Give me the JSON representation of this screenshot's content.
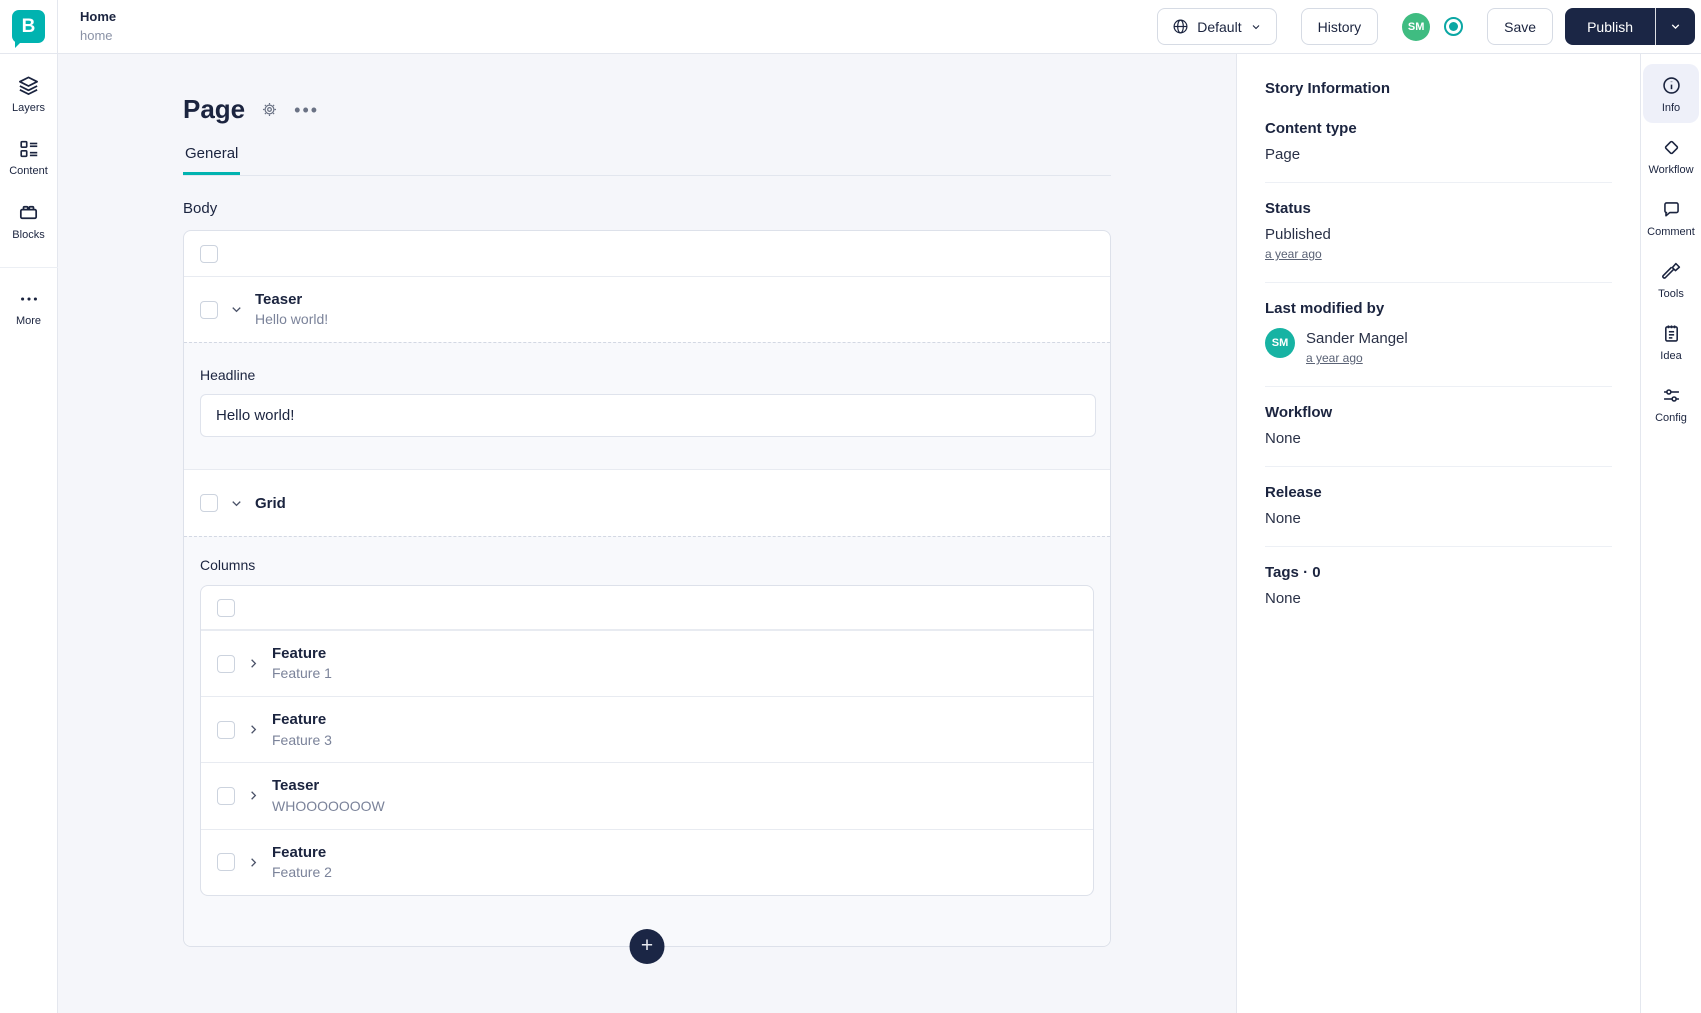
{
  "topbar": {
    "breadcrumb_title": "Home",
    "breadcrumb_slug": "home",
    "logo_letter": "B",
    "language_label": "Default",
    "history_label": "History",
    "avatar_initials": "SM",
    "save_label": "Save",
    "publish_label": "Publish"
  },
  "left_rail": {
    "items": [
      {
        "label": "Layers",
        "icon": "layers-icon"
      },
      {
        "label": "Content",
        "icon": "content-icon"
      },
      {
        "label": "Blocks",
        "icon": "blocks-icon"
      },
      {
        "label": "More",
        "icon": "more-icon"
      }
    ]
  },
  "editor": {
    "title": "Page",
    "tab_general": "General",
    "body_field_label": "Body",
    "add_label": "+",
    "teaser": {
      "component": "Teaser",
      "preview": "Hello world!"
    },
    "headline_label": "Headline",
    "headline_value": "Hello world!",
    "grid_component": "Grid",
    "columns_label": "Columns",
    "column_items": [
      {
        "component": "Feature",
        "preview": "Feature 1"
      },
      {
        "component": "Feature",
        "preview": "Feature 3"
      },
      {
        "component": "Teaser",
        "preview": "WHOOOOOOOW"
      },
      {
        "component": "Feature",
        "preview": "Feature 2"
      }
    ]
  },
  "sidebar": {
    "title": "Story Information",
    "content_type_label": "Content type",
    "content_type_value": "Page",
    "status_label": "Status",
    "status_value": "Published",
    "status_time": "a year ago",
    "modified_label": "Last modified by",
    "modified_initials": "SM",
    "modified_user": "Sander Mangel",
    "modified_time": "a year ago",
    "workflow_label": "Workflow",
    "workflow_value": "None",
    "release_label": "Release",
    "release_value": "None",
    "tags_label": "Tags · 0",
    "tags_value": "None"
  },
  "right_rail": {
    "items": [
      {
        "label": "Info",
        "icon": "info-icon",
        "active": true
      },
      {
        "label": "Workflow",
        "icon": "workflow-icon",
        "active": false
      },
      {
        "label": "Comment",
        "icon": "comment-icon",
        "active": false
      },
      {
        "label": "Tools",
        "icon": "tools-icon",
        "active": false
      },
      {
        "label": "Idea",
        "icon": "idea-icon",
        "active": false
      },
      {
        "label": "Config",
        "icon": "config-icon",
        "active": false
      }
    ]
  },
  "colors": {
    "brand_teal": "#00b3b0",
    "navy": "#1b2645",
    "avatar_green": "#3fbc81",
    "avatar_teal": "#17b3a3",
    "page_bg": "#f5f6fa"
  }
}
